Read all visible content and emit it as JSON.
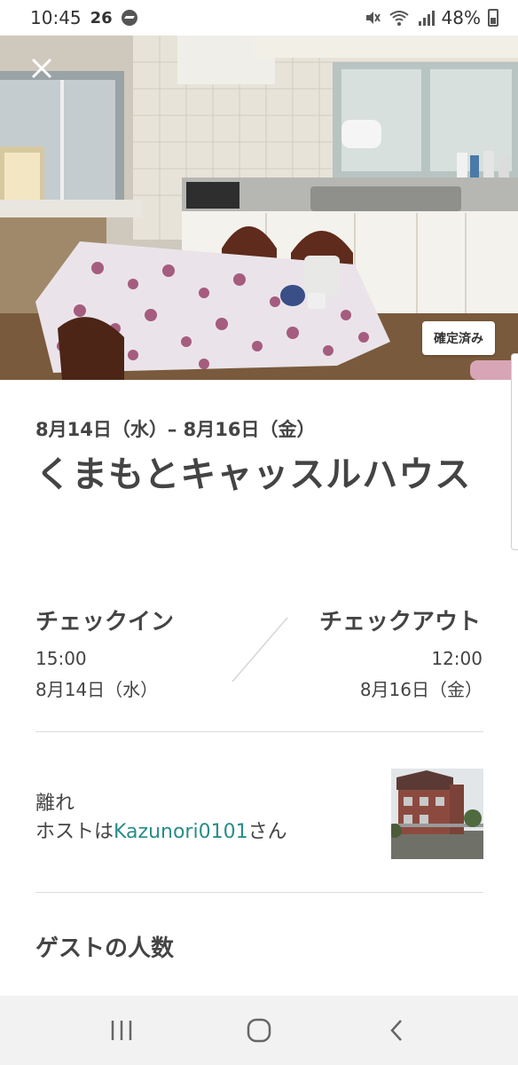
{
  "status_bar": {
    "time": "10:45",
    "extra": "26",
    "battery": "48%"
  },
  "hero": {
    "badge": "確定済み"
  },
  "trip": {
    "dates": "8月14日（水）– 8月16日（金）",
    "title": "くまもとキャッスルハウス"
  },
  "checkin": {
    "label": "チェックイン",
    "time": "15:00",
    "date": "8月14日（水）"
  },
  "checkout": {
    "label": "チェックアウト",
    "time": "12:00",
    "date": "8月16日（金）"
  },
  "listing": {
    "room_type": "離れ",
    "host_prefix": "ホストは",
    "host_name": "Kazunori0101",
    "host_suffix": "さん"
  },
  "guests": {
    "label": "ゲストの人数"
  },
  "icons": {
    "close": "close-icon",
    "recents": "recent-apps-icon",
    "home": "home-icon",
    "back": "back-icon"
  }
}
